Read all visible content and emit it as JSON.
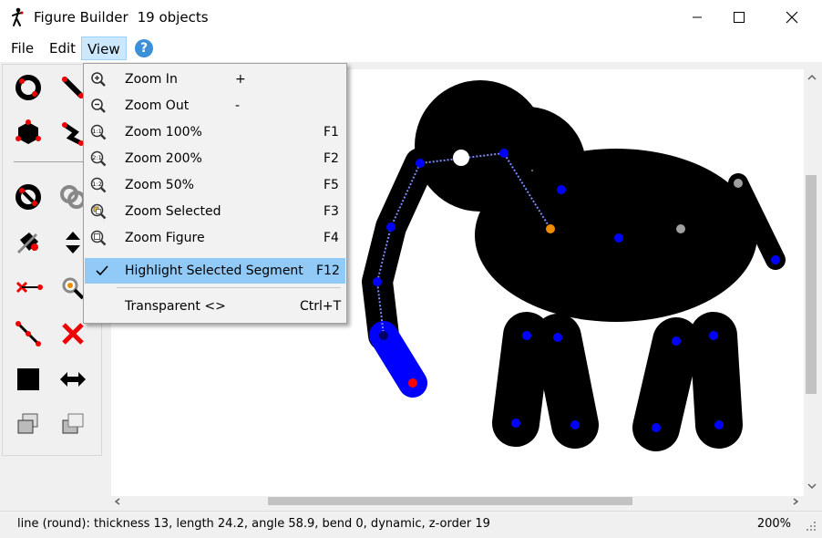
{
  "window": {
    "title": "Figure Builder",
    "object_count": "19 objects"
  },
  "menu": {
    "file": "File",
    "edit": "Edit",
    "view": "View",
    "help_label": "?"
  },
  "view_menu": [
    {
      "label": "Zoom In",
      "shortcut": "+",
      "icon": "zoom-in-icon"
    },
    {
      "label": "Zoom Out",
      "shortcut": "-",
      "icon": "zoom-out-icon"
    },
    {
      "label": "Zoom 100%",
      "shortcut": "F1",
      "icon": "zoom-100-icon",
      "badge": "1:1"
    },
    {
      "label": "Zoom 200%",
      "shortcut": "F2",
      "icon": "zoom-200-icon",
      "badge": "2:1"
    },
    {
      "label": "Zoom 50%",
      "shortcut": "F5",
      "icon": "zoom-50-icon",
      "badge": "1:2"
    },
    {
      "label": "Zoom Selected",
      "shortcut": "F3",
      "icon": "zoom-selected-icon"
    },
    {
      "label": "Zoom Figure",
      "shortcut": "F4",
      "icon": "zoom-figure-icon"
    },
    {
      "label": "Highlight Selected Segment",
      "shortcut": "F12",
      "icon": "checkmark-icon",
      "checked": true
    },
    {
      "label": "Transparent <>",
      "shortcut": "Ctrl+T"
    }
  ],
  "status": {
    "text": "line (round): thickness 13, length 24.2, angle 58.9, bend 0, dynamic, z-order 19",
    "zoom": "200%"
  },
  "colors": {
    "joint": "#0000ff",
    "selected_joint": "#ff0000",
    "orange_joint": "#f08c00",
    "grey_joint": "#a0a0a0",
    "segment": "#000000",
    "highlight_segment": "#0000ff"
  }
}
